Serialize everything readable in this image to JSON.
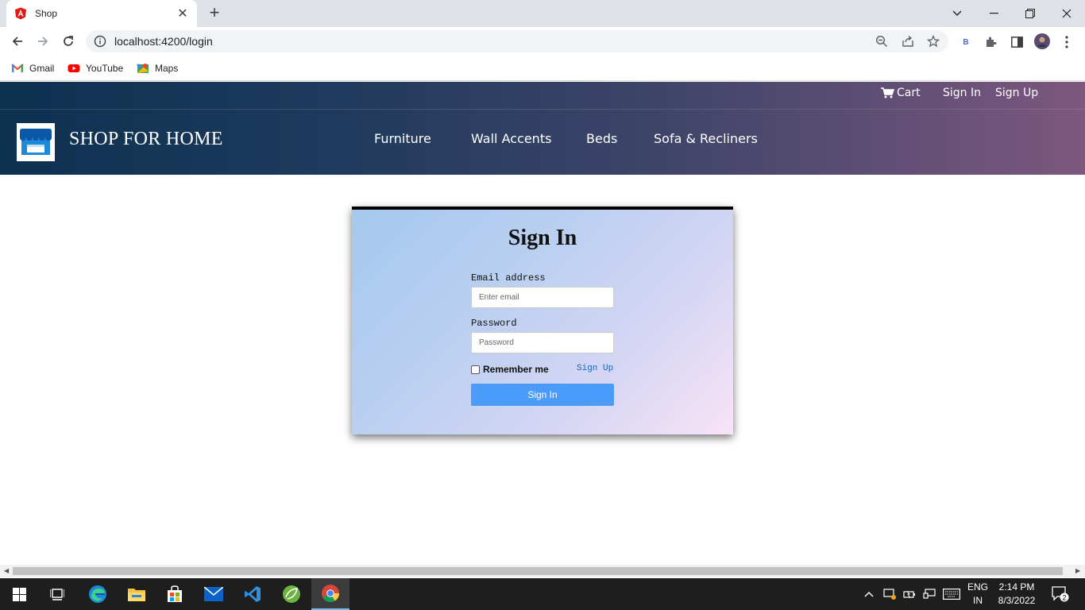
{
  "browser": {
    "tab_title": "Shop",
    "url": "localhost:4200/login",
    "bookmarks": [
      {
        "label": "Gmail",
        "icon": "gmail-icon"
      },
      {
        "label": "YouTube",
        "icon": "youtube-icon"
      },
      {
        "label": "Maps",
        "icon": "maps-icon"
      }
    ]
  },
  "site": {
    "brand": "SHOP FOR HOME",
    "top_links": {
      "cart": "Cart",
      "sign_in": "Sign In",
      "sign_up": "Sign Up"
    },
    "nav": [
      "Furniture",
      "Wall Accents",
      "Beds",
      "Sofa & Recliners"
    ]
  },
  "login": {
    "title": "Sign In",
    "email_label": "Email address",
    "email_placeholder": "Enter email",
    "email_value": "",
    "password_label": "Password",
    "password_placeholder": "Password",
    "password_value": "",
    "remember_label": "Remember me",
    "remember_checked": false,
    "signup_link": "Sign Up",
    "submit_label": "Sign In"
  },
  "taskbar": {
    "lang_line1": "ENG",
    "lang_line2": "IN",
    "time": "2:14 PM",
    "date": "8/3/2022",
    "notifications": "2"
  },
  "colors": {
    "header_start": "#0e3150",
    "header_end": "#7d577f",
    "button": "#4a9bfa",
    "card_border": "#000000"
  }
}
